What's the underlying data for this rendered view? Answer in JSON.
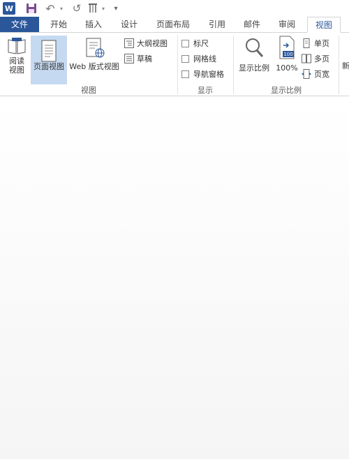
{
  "qat": {
    "app_icon": "W",
    "customize_glyph": "▾",
    "undo_glyph": "↶",
    "redo_glyph": "↺",
    "arrow_glyph": "▾"
  },
  "tabs": [
    {
      "label": "文件"
    },
    {
      "label": "开始"
    },
    {
      "label": "插入"
    },
    {
      "label": "设计"
    },
    {
      "label": "页面布局"
    },
    {
      "label": "引用"
    },
    {
      "label": "邮件"
    },
    {
      "label": "审阅"
    },
    {
      "label": "视图"
    }
  ],
  "ribbon": {
    "views": {
      "group_label": "视图",
      "read_mode_line1": "阅读",
      "read_mode_line2": "视图",
      "print_layout": "页面视图",
      "web_layout": "Web 版式视图",
      "outline": "大纲视图",
      "draft": "草稿"
    },
    "show": {
      "group_label": "显示",
      "ruler": "标尺",
      "gridlines": "网格线",
      "navigation_pane": "导航窗格"
    },
    "zoom": {
      "group_label": "显示比例",
      "zoom": "显示比例",
      "hundred_percent": "100%",
      "hundred_icon_text": "100",
      "one_page": "单页",
      "multiple_pages": "多页",
      "page_width": "页宽"
    },
    "window": {
      "new_window_partial": "新"
    }
  },
  "colors": {
    "accent": "#2b579a",
    "selected_bg": "#c5d9f1"
  }
}
